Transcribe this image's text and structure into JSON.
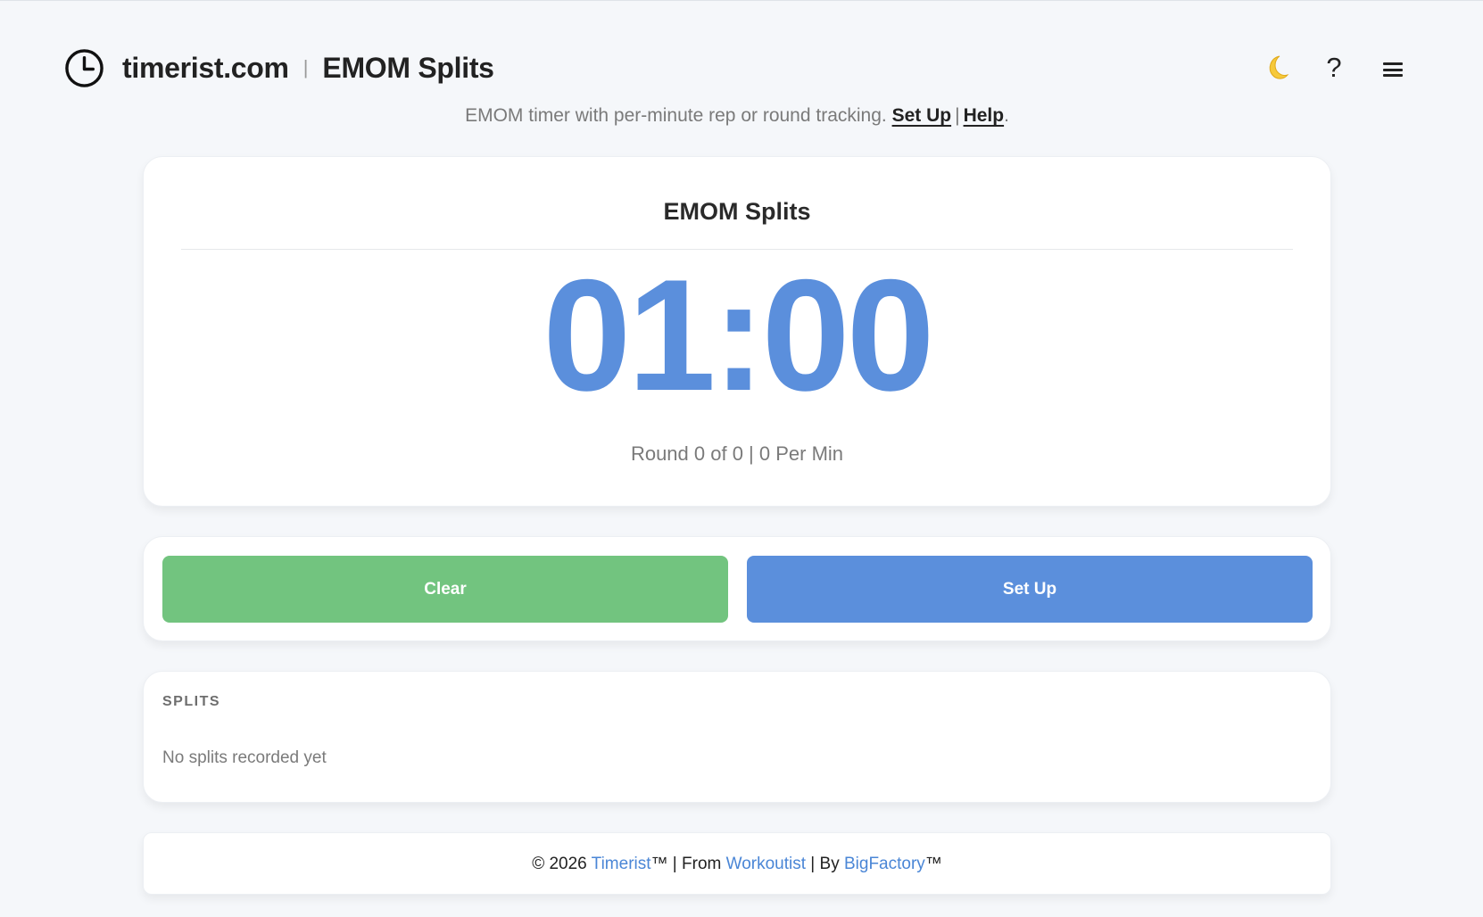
{
  "header": {
    "brand": "timerist.com",
    "separator": "|",
    "title": "EMOM Splits",
    "icons": [
      "clock-icon",
      "moon-icon",
      "help-icon",
      "menu-icon"
    ],
    "help_label": "?"
  },
  "tagline": {
    "text": "EMOM timer with per-minute rep or round tracking.",
    "setup_link": "Set Up",
    "pipe": "|",
    "help_link": "Help",
    "end": "."
  },
  "timer": {
    "title": "EMOM Splits",
    "display": "01:00",
    "round_info": "Round 0 of 0 | 0 Per Min",
    "color": "#5b8fdc"
  },
  "controls": {
    "clear_label": "Clear",
    "setup_label": "Set Up",
    "clear_color": "#72c47f",
    "setup_color": "#5b8fdc"
  },
  "splits": {
    "heading": "SPLITS",
    "empty_text": "No splits recorded yet"
  },
  "footer": {
    "prefix": "© 2026 ",
    "timerist_link": "Timerist",
    "after_timerist": "™ | From ",
    "workoutist_link": "Workoutist",
    "after_workoutist": " | By ",
    "bigfactory_link": "BigFactory",
    "suffix": "™"
  }
}
